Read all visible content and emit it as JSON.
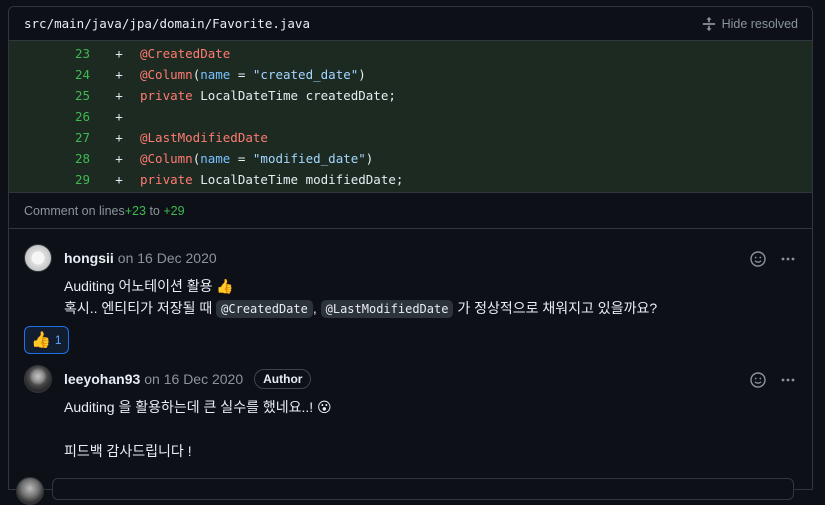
{
  "file": {
    "path": "src/main/java/jpa/domain/Favorite.java",
    "hide_resolved": "Hide resolved"
  },
  "diff_lines": [
    {
      "num": "23",
      "sign": "+"
    },
    {
      "num": "24",
      "sign": "+"
    },
    {
      "num": "25",
      "sign": "+"
    },
    {
      "num": "26",
      "sign": "+"
    },
    {
      "num": "27",
      "sign": "+"
    },
    {
      "num": "28",
      "sign": "+"
    },
    {
      "num": "29",
      "sign": "+"
    }
  ],
  "code": {
    "l23_ann": "@CreatedDate",
    "l24_ann": "@Column",
    "l24_open": "(",
    "l24_attr": "name",
    "l24_eq": " = ",
    "l24_str": "\"created_date\"",
    "l24_close": ")",
    "l25_kw": "private",
    "l25_rest": " LocalDateTime createdDate;",
    "l27_ann": "@LastModifiedDate",
    "l28_ann": "@Column",
    "l28_open": "(",
    "l28_attr": "name",
    "l28_eq": " = ",
    "l28_str": "\"modified_date\"",
    "l28_close": ")",
    "l29_kw": "private",
    "l29_rest": " LocalDateTime modifiedDate;"
  },
  "comment_on": {
    "prefix": "Comment on lines ",
    "from": "+23",
    "to_word": " to ",
    "to": "+29"
  },
  "comments": [
    {
      "author": "hongsii",
      "date": "on 16 Dec 2020",
      "line1": "Auditing 어노테이션 활용 👍",
      "line2_pre": "혹시.. 엔티티가 저장될 때 ",
      "code1": "@CreatedDate",
      "sep": ", ",
      "code2": "@LastModifiedDate",
      "line2_post": " 가 정상적으로 채워지고 있을까요?",
      "reaction_emoji": "👍",
      "reaction_count": "1"
    },
    {
      "author": "leeyohan93",
      "date": "on 16 Dec 2020",
      "badge": "Author",
      "line1": "Auditing 을 활용하는데 큰 실수를 했네요..! 😮",
      "line2": "피드백 감사드립니다 !"
    }
  ],
  "icons": {
    "unfold": "unfold-icon",
    "smiley": "smiley-icon",
    "kebab": "kebab-horizontal-icon"
  },
  "colors": {
    "added_bg": "#1c2a22",
    "line_num": "#3fb950",
    "annotation": "#ff7b72",
    "attr": "#79c0ff",
    "string": "#a5d6ff",
    "link_blue": "#58a6ff"
  }
}
